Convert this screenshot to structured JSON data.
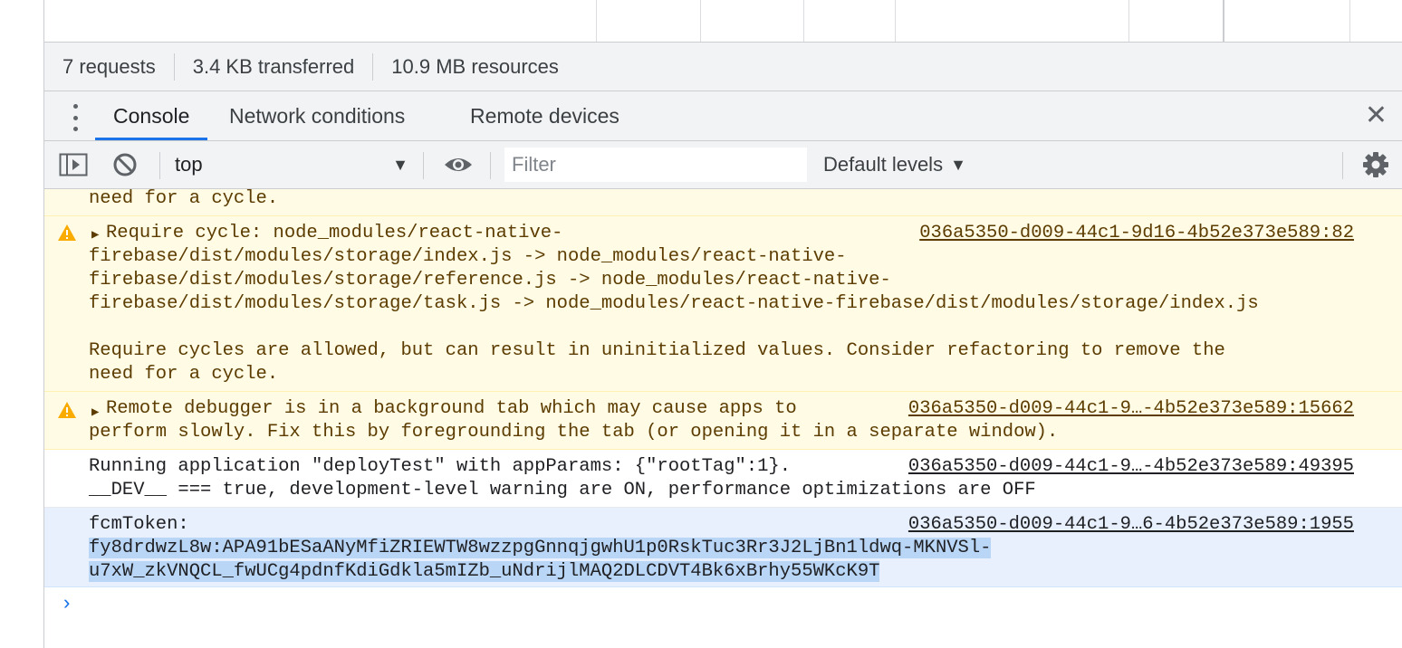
{
  "summary": {
    "requests": "7 requests",
    "transferred": "3.4 KB transferred",
    "resources": "10.9 MB resources"
  },
  "drawer": {
    "tabs": [
      "Console",
      "Network conditions",
      "Remote devices"
    ],
    "active_tab": "Console"
  },
  "toolbar": {
    "context": "top",
    "filter_placeholder": "Filter",
    "levels": "Default levels"
  },
  "messages": [
    {
      "level": "warning",
      "lines": [
        "need for a cycle."
      ]
    },
    {
      "level": "warning",
      "source": "036a5350-d009-44c1-9d16-4b52e373e589:82",
      "lines": [
        "Require cycle: node_modules/react-native-",
        "firebase/dist/modules/storage/index.js -> node_modules/react-native-",
        "firebase/dist/modules/storage/reference.js -> node_modules/react-native-",
        "firebase/dist/modules/storage/task.js -> node_modules/react-native-firebase/dist/modules/storage/index.js",
        "",
        "Require cycles are allowed, but can result in uninitialized values. Consider refactoring to remove the",
        "need for a cycle."
      ]
    },
    {
      "level": "warning",
      "source": "036a5350-d009-44c1-9…-4b52e373e589:15662",
      "lines": [
        "Remote debugger is in a background tab which may cause apps to",
        "perform slowly. Fix this by foregrounding the tab (or opening it in a separate window)."
      ]
    },
    {
      "level": "info",
      "source": "036a5350-d009-44c1-9…-4b52e373e589:49395",
      "lines": [
        "Running application \"deployTest\" with appParams: {\"rootTag\":1}.",
        "__DEV__ === true, development-level warning are ON, performance optimizations are OFF"
      ]
    },
    {
      "level": "info",
      "selected": true,
      "source": "036a5350-d009-44c1-9…6-4b52e373e589:1955",
      "lines": [
        "fcmToken:",
        "fy8drdwzL8w:APA91bESaANyMfiZRIEWTW8wzzpgGnnqjgwhU1p0RskTuc3Rr3J2LjBn1ldwq-MKNVSl-",
        "u7xW_zkVNQCL_fwUCg4pdnfKdiGdkla5mIZb_uNdrijlMAQ2DLCDVT4Bk6xBrhy55WKcK9T"
      ]
    }
  ],
  "prompt_symbol": "›",
  "colors": {
    "accent": "#1a73e8",
    "warning_bg": "#fffbe5",
    "warning_text": "#5c3c00",
    "selection": "#bad6f7"
  }
}
